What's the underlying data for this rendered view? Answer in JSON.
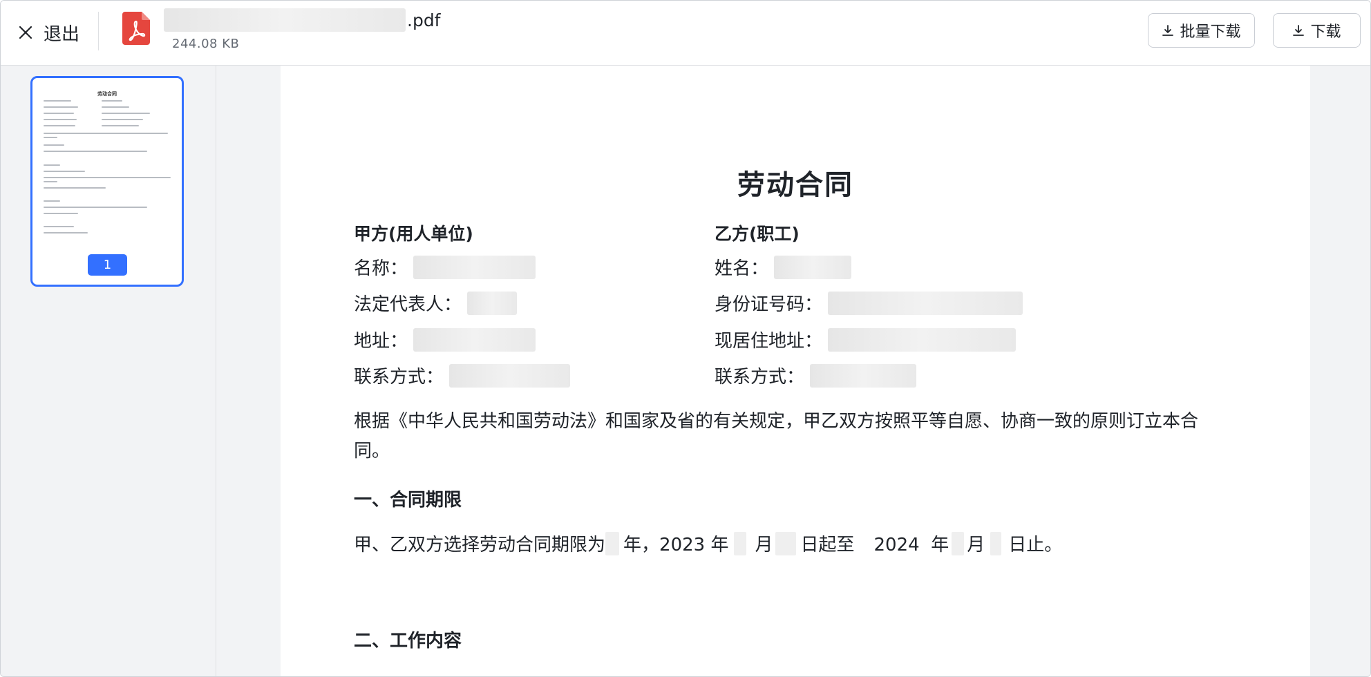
{
  "header": {
    "exit_label": "退出",
    "file_ext": ".pdf",
    "file_size": "244.08 KB",
    "batch_download_label": "批量下载",
    "download_label": "下载"
  },
  "sidebar": {
    "thumbnail_title": "劳动合同",
    "page_number": "1"
  },
  "document": {
    "title": "劳动合同",
    "party_a": {
      "heading": "甲方(用人单位)",
      "name_label": "名称：",
      "legal_rep_label": "法定代表人：",
      "address_label": "地址：",
      "contact_label": "联系方式："
    },
    "party_b": {
      "heading": "乙方(职工)",
      "name_label": "姓名：",
      "id_label": "身份证号码：",
      "residence_label": "现居住地址：",
      "contact_label": "联系方式："
    },
    "intro": "根据《中华人民共和国劳动法》和国家及省的有关规定，甲乙双方按照平等自愿、协商一致的原则订立本合同。",
    "section1_heading": "一、合同期限",
    "period": {
      "prefix": "甲、乙双方选择劳动合同期限为",
      "year_unit": "年，",
      "start_year": "2023 年",
      "month1": "月",
      "day_from": "日起至",
      "end_year": "2024  年",
      "month2": "月",
      "day_until": "日止。"
    },
    "section2_heading": "二、工作内容"
  },
  "colors": {
    "accent": "#3370ff",
    "pdf_red": "#e5463e",
    "sidebar_bg": "#f2f3f5"
  }
}
